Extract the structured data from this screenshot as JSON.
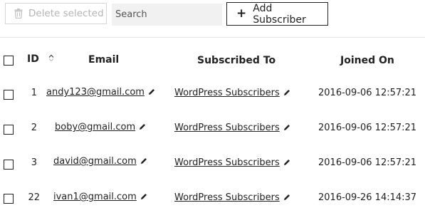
{
  "toolbar": {
    "delete_label": "Delete selected",
    "search_placeholder": "Search",
    "add_label": "Add Subscriber"
  },
  "table": {
    "headers": {
      "id": "ID",
      "email": "Email",
      "subscribed_to": "Subscribed To",
      "joined_on": "Joined On"
    },
    "rows": [
      {
        "id": "1",
        "email": "andy123@gmail.com",
        "subscribed_to": "WordPress Subscribers",
        "joined_on": "2016-09-06 12:57:21"
      },
      {
        "id": "2",
        "email": "boby@gmail.com",
        "subscribed_to": "WordPress Subscribers",
        "joined_on": "2016-09-06 12:57:21"
      },
      {
        "id": "3",
        "email": "david@gmail.com",
        "subscribed_to": "WordPress Subscribers",
        "joined_on": "2016-09-06 12:57:21"
      },
      {
        "id": "22",
        "email": "ivan1@gmail.com",
        "subscribed_to": "WordPress Subscribers",
        "joined_on": "2016-09-26 14:14:37"
      }
    ]
  }
}
